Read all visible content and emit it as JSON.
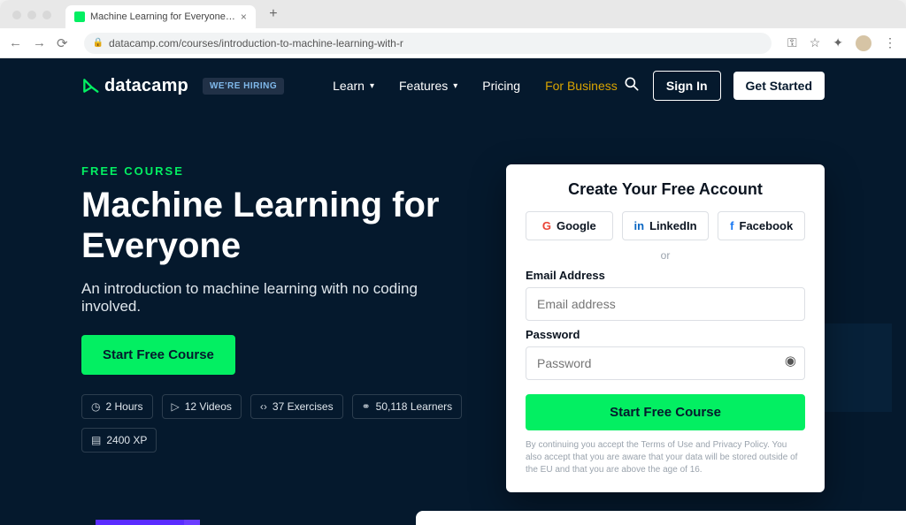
{
  "browser": {
    "tab_title": "Machine Learning for Everyone…",
    "url": "datacamp.com/courses/introduction-to-machine-learning-with-r"
  },
  "header": {
    "brand": "datacamp",
    "hiring_badge": "WE'RE HIRING",
    "nav": {
      "learn": "Learn",
      "features": "Features",
      "pricing": "Pricing",
      "business": "For Business"
    },
    "sign_in": "Sign In",
    "get_started": "Get Started"
  },
  "hero": {
    "tag": "FREE COURSE",
    "title": "Machine Learning for Everyone",
    "subtitle": "An introduction to machine learning with no coding involved.",
    "cta": "Start Free Course",
    "stats": {
      "hours": "2 Hours",
      "videos": "12 Videos",
      "exercises": "37 Exercises",
      "learners": "50,118 Learners",
      "xp": "2400 XP"
    }
  },
  "signup": {
    "title": "Create Your Free Account",
    "google": "Google",
    "linkedin": "LinkedIn",
    "facebook": "Facebook",
    "or": "or",
    "email_label": "Email Address",
    "email_placeholder": "Email address",
    "password_label": "Password",
    "password_placeholder": "Password",
    "cta": "Start Free Course",
    "legal": "By continuing you accept the Terms of Use and Privacy Policy. You also accept that you are aware that your data will be stored outside of the EU and that you are above the age of 16."
  }
}
